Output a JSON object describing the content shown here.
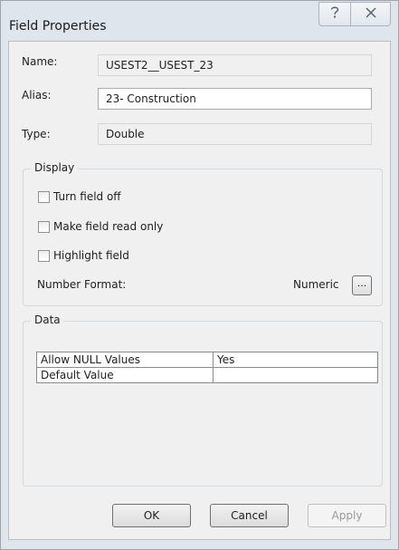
{
  "window": {
    "title": "Field Properties",
    "help_icon": "help-question-icon",
    "close_icon": "close-x-icon"
  },
  "fields": {
    "name_label": "Name:",
    "name_value": "USEST2__USEST_23",
    "alias_label": "Alias:",
    "alias_value": "23- Construction",
    "type_label": "Type:",
    "type_value": "Double"
  },
  "display": {
    "title": "Display",
    "turn_off_label": "Turn field off",
    "turn_off_checked": false,
    "read_only_label": "Make field read only",
    "read_only_checked": false,
    "highlight_label": "Highlight field",
    "highlight_checked": false,
    "number_format_label": "Number Format:",
    "number_format_value": "Numeric",
    "number_format_button": "..."
  },
  "data": {
    "title": "Data",
    "rows": [
      {
        "property": "Allow NULL Values",
        "value": "Yes"
      },
      {
        "property": "Default Value",
        "value": ""
      }
    ]
  },
  "buttons": {
    "ok": "OK",
    "cancel": "Cancel",
    "apply": "Apply",
    "apply_enabled": false
  }
}
